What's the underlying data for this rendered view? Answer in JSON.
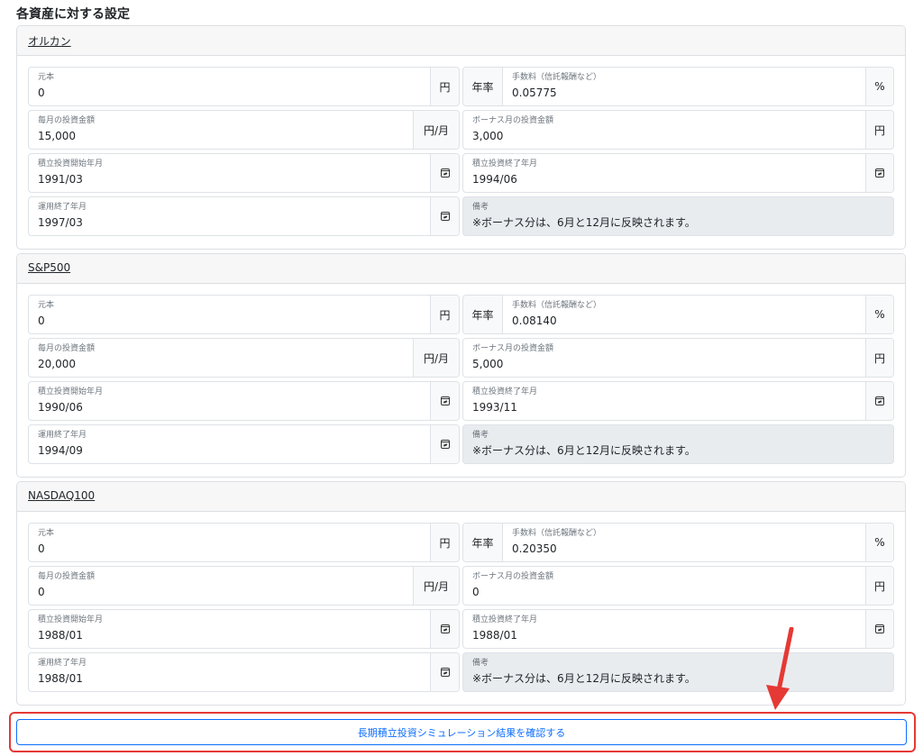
{
  "page": {
    "title": "各資産に対する設定"
  },
  "labels": {
    "principal": "元本",
    "rate_prefix": "年率",
    "fee": "手数料（信託報酬など）",
    "monthly": "毎月の投資金額",
    "bonus": "ボーナス月の投資金額",
    "start": "積立投資開始年月",
    "end": "積立投資終了年月",
    "run_end": "運用終了年月",
    "note": "備考"
  },
  "units": {
    "yen": "円",
    "yen_per_month": "円/月",
    "percent": "%"
  },
  "assets": [
    {
      "name": "オルカン",
      "principal": "0",
      "fee": "0.05775",
      "monthly": "15,000",
      "bonus": "3,000",
      "start": "1991/03",
      "end": "1994/06",
      "run_end": "1997/03",
      "note": "※ボーナス分は、6月と12月に反映されます。"
    },
    {
      "name": "S&P500",
      "principal": "0",
      "fee": "0.08140",
      "monthly": "20,000",
      "bonus": "5,000",
      "start": "1990/06",
      "end": "1993/11",
      "run_end": "1994/09",
      "note": "※ボーナス分は、6月と12月に反映されます。"
    },
    {
      "name": "NASDAQ100",
      "principal": "0",
      "fee": "0.20350",
      "monthly": "0",
      "bonus": "0",
      "start": "1988/01",
      "end": "1988/01",
      "run_end": "1988/01",
      "note": "※ボーナス分は、6月と12月に反映されます。"
    }
  ],
  "submit": {
    "label": "長期積立投資シミュレーション結果を確認する"
  },
  "colors": {
    "highlight": "#e53935",
    "primary": "#0d6efd"
  }
}
